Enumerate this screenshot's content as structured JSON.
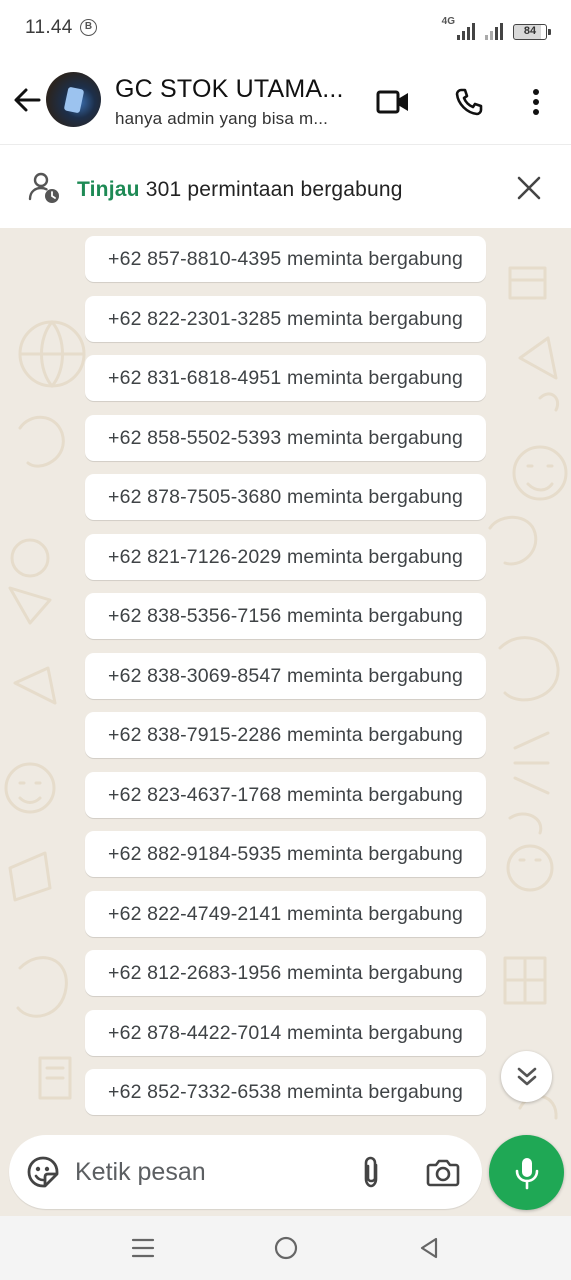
{
  "status_bar": {
    "time": "11.44",
    "notification_icon": "b-circle-icon",
    "network": "4G",
    "battery": "84"
  },
  "header": {
    "title": "GC STOK UTAMA...",
    "subtitle": "hanya admin yang bisa m...",
    "icons": {
      "back": "arrow-left-icon",
      "video": "video-camera-icon",
      "call": "phone-icon",
      "more": "more-vertical-icon"
    }
  },
  "notice": {
    "link": "Tinjau",
    "text": " 301 permintaan bergabung",
    "icon": "user-pending-icon",
    "close_icon": "close-icon"
  },
  "messages": [
    "+62 857-8810-4395 meminta bergabung",
    "+62 822-2301-3285 meminta bergabung",
    "+62 831-6818-4951 meminta bergabung",
    "+62 858-5502-5393 meminta bergabung",
    "+62 878-7505-3680 meminta bergabung",
    "+62 821-7126-2029 meminta bergabung",
    "+62 838-5356-7156 meminta bergabung",
    "+62 838-3069-8547 meminta bergabung",
    "+62 838-7915-2286 meminta bergabung",
    "+62 823-4637-1768 meminta bergabung",
    "+62 882-9184-5935 meminta bergabung",
    "+62 822-4749-2141 meminta bergabung",
    "+62 812-2683-1956 meminta bergabung",
    "+62 878-4422-7014 meminta bergabung",
    "+62 852-7332-6538 meminta bergabung"
  ],
  "composer": {
    "placeholder": "Ketik pesan",
    "icons": {
      "sticker": "sticker-icon",
      "attach": "paperclip-icon",
      "camera": "camera-icon",
      "mic": "microphone-icon",
      "scroll_down": "double-chevron-down-icon"
    }
  },
  "colors": {
    "accent_green": "#1fa855",
    "link_green": "#1e8a55",
    "chat_background": "#efeae2"
  },
  "nav_bar": {
    "icons": {
      "recents": "recents-icon",
      "home": "home-circle-icon",
      "back": "back-triangle-icon"
    }
  }
}
